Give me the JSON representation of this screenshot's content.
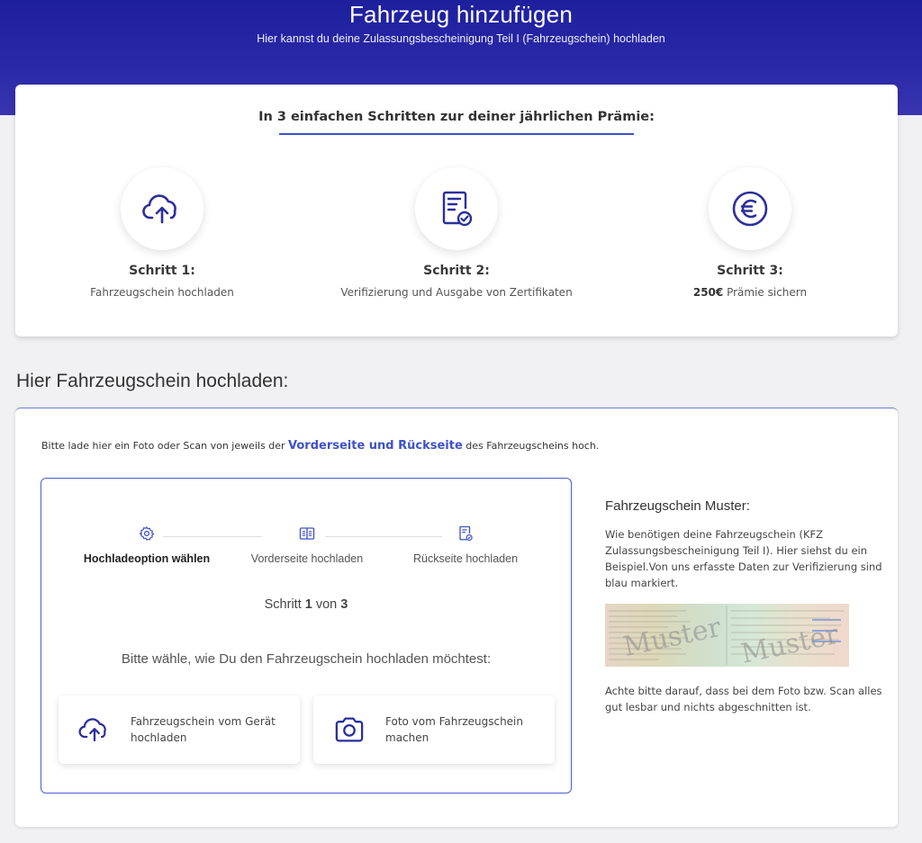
{
  "header": {
    "title": "Fahrzeug hinzufügen",
    "subtitle": "Hier kannst du deine Zulassungsbescheinigung Teil I (Fahrzeugschein) hochladen"
  },
  "steps_card": {
    "title": "In 3 einfachen Schritten zur deiner jährlichen Prämie:",
    "steps": [
      {
        "icon": "cloud-upload-icon",
        "title": "Schritt 1:",
        "desc": "Fahrzeugschein hochladen"
      },
      {
        "icon": "certificate-check-icon",
        "title": "Schritt 2:",
        "desc": "Verifizierung und Ausgabe von Zertifikaten"
      },
      {
        "icon": "euro-icon",
        "title": "Schritt 3:",
        "desc_bold": "250€",
        "desc": "Prämie sichern"
      }
    ]
  },
  "upload": {
    "heading": "Hier Fahrzeugschein hochladen:",
    "intro_before": "Bitte lade hier ein Foto oder Scan von jeweils der",
    "intro_highlight": "Vorderseite und Rückseite",
    "intro_after": "des Fahrzeugscheins hoch.",
    "wizard": {
      "steps": [
        {
          "icon": "gear-icon",
          "label": "Hochladeoption wählen",
          "active": true
        },
        {
          "icon": "book-icon",
          "label": "Vorderseite hochladen",
          "active": false
        },
        {
          "icon": "document-check-icon",
          "label": "Rückseite hochladen",
          "active": false
        }
      ],
      "counter_prefix": "Schritt",
      "counter_current": "1",
      "counter_mid": "von",
      "counter_total": "3",
      "question": "Bitte wähle, wie Du den Fahrzeugschein hochladen möchtest:",
      "options": [
        {
          "icon": "cloud-upload-icon",
          "label": "Fahrzeugschein vom Gerät hochladen"
        },
        {
          "icon": "camera-icon",
          "label": "Foto vom Fahrzeugschein machen"
        }
      ]
    },
    "sample": {
      "title": "Fahrzeugschein Muster:",
      "text1": "Wie benötigen deine Fahrzeugschein (KFZ Zulassungsbescheinigung Teil I). Hier siehst du ein Beispiel.Von uns erfasste Daten zur Verifizierung sind blau markiert.",
      "image_watermark_1": "Muster",
      "image_watermark_2": "Muster",
      "text2": "Achte bitte darauf, dass bei dem Foto bzw. Scan alles gut lesbar und nichts abgeschnitten ist."
    }
  },
  "colors": {
    "accent": "#3f51c8",
    "header_bg": "#2323a0",
    "icon": "#2b2f9c"
  }
}
